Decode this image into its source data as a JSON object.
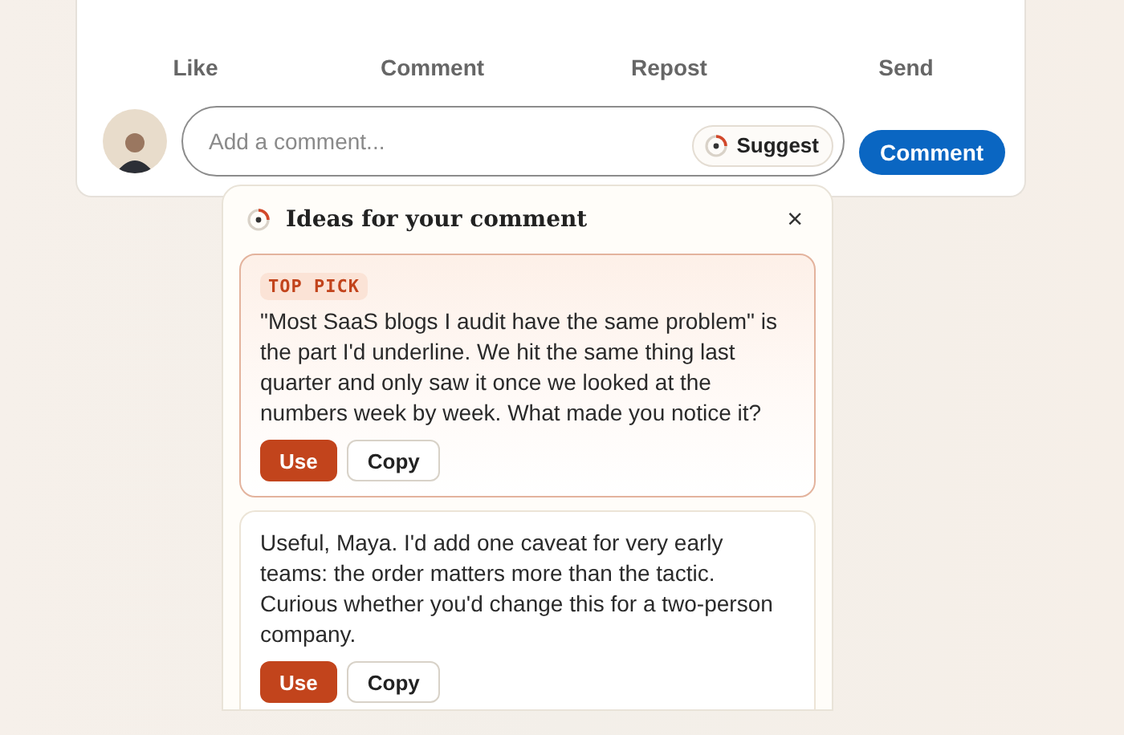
{
  "post_actions": [
    "Like",
    "Comment",
    "Repost",
    "Send"
  ],
  "comment_box": {
    "placeholder": "Add a comment...",
    "suggest_label": "Suggest",
    "submit_label": "Comment"
  },
  "ideas_popup": {
    "title": "Ideas for your comment",
    "close": "×",
    "suggestions": [
      {
        "kind": "top_pick",
        "badge": "TOP PICK",
        "text": "\"Most SaaS blogs I audit have the same problem\" is the part I'd underline. We hit the same thing last quarter and only saw it once we looked at the numbers week by week. What made you notice it?",
        "use_label": "Use",
        "copy_label": "Copy"
      },
      {
        "kind": "regular",
        "text": "Useful, Maya. I'd add one caveat for very early teams: the order matters more than the tactic. Curious whether you'd change this for a two-person company.",
        "use_label": "Use",
        "copy_label": "Copy"
      }
    ]
  }
}
